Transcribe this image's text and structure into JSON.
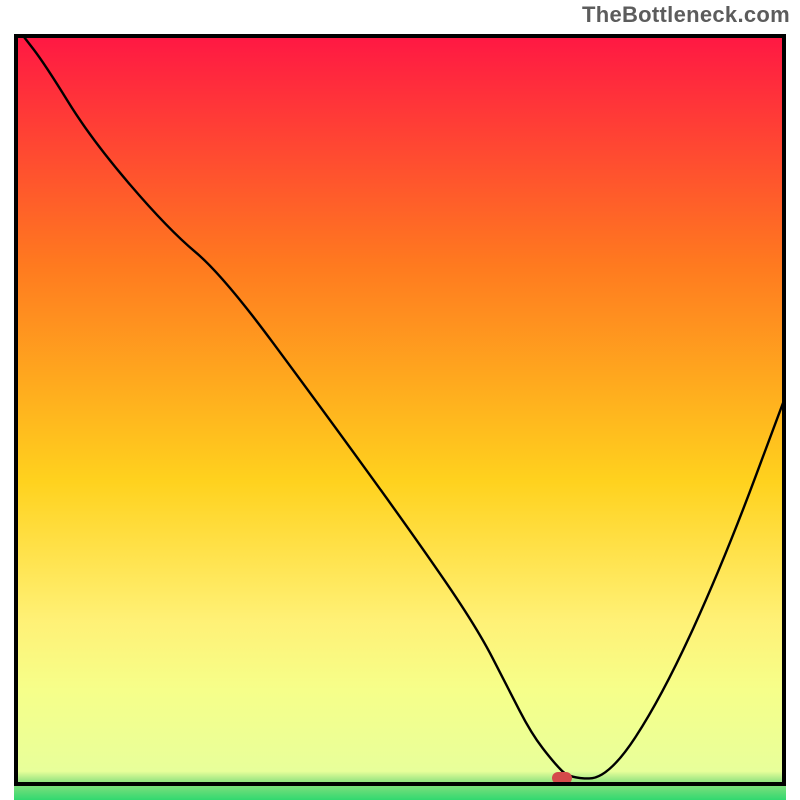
{
  "watermark": {
    "text": "TheBottleneck.com"
  },
  "colors": {
    "top": "#ff1744",
    "mid_upper": "#ff7a1f",
    "mid": "#ffd21e",
    "mid_lower": "#fff176",
    "band": "#f6ff8a",
    "bottom_green": "#12d66b",
    "curve": "#000000",
    "frame": "#000000",
    "marker": "#d44a4a"
  },
  "chart_data": {
    "type": "line",
    "title": "",
    "xlabel": "",
    "ylabel": "",
    "xlim": [
      0,
      100
    ],
    "ylim": [
      0,
      100
    ],
    "series": [
      {
        "name": "bottleneck-curve",
        "x": [
          1,
          4,
          10,
          20,
          27,
          40,
          52,
          60,
          64,
          67,
          70,
          72,
          77,
          84,
          92,
          100
        ],
        "y": [
          100,
          96,
          86,
          74,
          68,
          50,
          33,
          21,
          13,
          7,
          3,
          1,
          1,
          12,
          30,
          52
        ]
      }
    ],
    "marker": {
      "x": 71,
      "y": 1,
      "w": 2.5,
      "h": 1.6
    },
    "gradient_stops": [
      {
        "offset": 0,
        "color": "#ff1744"
      },
      {
        "offset": 30,
        "color": "#ff7a1f"
      },
      {
        "offset": 58,
        "color": "#ffd21e"
      },
      {
        "offset": 76,
        "color": "#fff176"
      },
      {
        "offset": 85,
        "color": "#f6ff8a"
      },
      {
        "offset": 95.5,
        "color": "#e8ff9a"
      },
      {
        "offset": 97,
        "color": "#8ce07e"
      },
      {
        "offset": 100,
        "color": "#12d66b"
      }
    ]
  }
}
